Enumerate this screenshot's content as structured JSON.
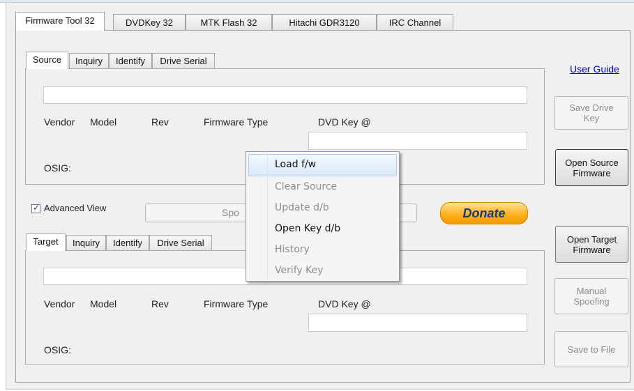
{
  "main_tabs": [
    "Firmware Tool 32",
    "DVDKey 32",
    "MTK Flash 32",
    "Hitachi GDR3120",
    "IRC Channel"
  ],
  "source_panel": {
    "tabs": [
      "Source",
      "Inquiry",
      "Identify",
      "Drive Serial"
    ],
    "field_labels": {
      "vendor": "Vendor",
      "model": "Model",
      "rev": "Rev",
      "firmware_type": "Firmware Type",
      "dvd_key": "DVD Key @",
      "osig": "OSIG:"
    },
    "main_value": "",
    "dvd_key_value": ""
  },
  "target_panel": {
    "tabs": [
      "Target",
      "Inquiry",
      "Identify",
      "Drive Serial"
    ],
    "field_labels": {
      "vendor": "Vendor",
      "model": "Model",
      "rev": "Rev",
      "firmware_type": "Firmware Type",
      "dvd_key": "DVD Key @",
      "osig": "OSIG:"
    },
    "main_value": "",
    "dvd_key_value": ""
  },
  "advanced_view": {
    "label": "Advanced View",
    "checked": true,
    "checkmark": "✓"
  },
  "spoof_button_label": "Spo",
  "donate_label": "Donate",
  "right_buttons": {
    "user_guide": "User Guide",
    "save_drive_key": "Save Drive\nKey",
    "open_source_firmware": "Open Source\nFirmware",
    "open_target_firmware": "Open Target\nFirmware",
    "manual_spoofing": "Manual\nSpoofing",
    "save_to_file": "Save to File"
  },
  "context_menu": [
    {
      "label": "Load f/w",
      "enabled": true,
      "highlighted": true
    },
    {
      "label": "Clear Source",
      "enabled": false
    },
    {
      "label": "Update d/b",
      "enabled": false
    },
    {
      "label": "Open Key d/b",
      "enabled": true
    },
    {
      "label": "History",
      "enabled": false
    },
    {
      "label": "Verify Key",
      "enabled": false
    }
  ],
  "colors": {
    "accent_highlight": "#dbe9f9",
    "link": "#0000ee",
    "donate": "#ffb21e"
  }
}
